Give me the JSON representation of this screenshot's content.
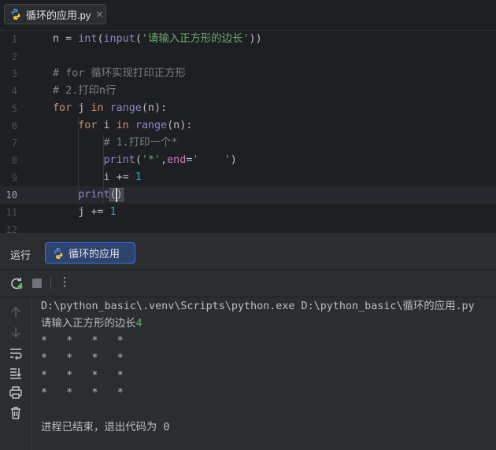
{
  "file_tab": {
    "label": "循环的应用.py",
    "close_glyph": "×",
    "icon": "python-icon"
  },
  "editor": {
    "line_numbers": [
      "1",
      "2",
      "3",
      "4",
      "5",
      "6",
      "7",
      "8",
      "9",
      "10",
      "11",
      "12"
    ],
    "current_line": "10",
    "lines": [
      {
        "tokens": [
          {
            "t": "n = ",
            "c": "id"
          },
          {
            "t": "int",
            "c": "bi"
          },
          {
            "t": "(",
            "c": "id"
          },
          {
            "t": "input",
            "c": "bi"
          },
          {
            "t": "(",
            "c": "id"
          },
          {
            "t": "'请输入正方形的边长'",
            "c": "str"
          },
          {
            "t": "))",
            "c": "id"
          }
        ]
      },
      {
        "tokens": []
      },
      {
        "tokens": [
          {
            "t": "# for 循环实现打印正方形",
            "c": "cmt"
          }
        ]
      },
      {
        "tokens": [
          {
            "t": "# 2.打印n行",
            "c": "cmt"
          }
        ]
      },
      {
        "tokens": [
          {
            "t": "for",
            "c": "kw"
          },
          {
            "t": " j ",
            "c": "id"
          },
          {
            "t": "in",
            "c": "kw"
          },
          {
            "t": " ",
            "c": "id"
          },
          {
            "t": "range",
            "c": "bi"
          },
          {
            "t": "(n):",
            "c": "id"
          }
        ]
      },
      {
        "tokens": [
          {
            "t": "    ",
            "c": "id"
          },
          {
            "t": "for",
            "c": "kw"
          },
          {
            "t": " i ",
            "c": "id"
          },
          {
            "t": "in",
            "c": "kw"
          },
          {
            "t": " ",
            "c": "id"
          },
          {
            "t": "range",
            "c": "bi"
          },
          {
            "t": "(n):",
            "c": "id"
          }
        ]
      },
      {
        "tokens": [
          {
            "t": "        ",
            "c": "id"
          },
          {
            "t": "# 1.打印一个*",
            "c": "cmt"
          }
        ]
      },
      {
        "tokens": [
          {
            "t": "        ",
            "c": "id"
          },
          {
            "t": "print",
            "c": "bi"
          },
          {
            "t": "(",
            "c": "id"
          },
          {
            "t": "'*'",
            "c": "str"
          },
          {
            "t": ",",
            "c": "id"
          },
          {
            "t": "end",
            "c": "par"
          },
          {
            "t": "=",
            "c": "id"
          },
          {
            "t": "'    '",
            "c": "str"
          },
          {
            "t": ")",
            "c": "id"
          }
        ]
      },
      {
        "tokens": [
          {
            "t": "        i += ",
            "c": "id"
          },
          {
            "t": "1",
            "c": "num"
          }
        ]
      },
      {
        "tokens": [
          {
            "t": "    ",
            "c": "id"
          },
          {
            "t": "print",
            "c": "bi"
          },
          {
            "t": "(",
            "c": "id",
            "hl": true
          },
          {
            "t": ")",
            "c": "id",
            "hl": true
          }
        ]
      },
      {
        "tokens": [
          {
            "t": "    j += ",
            "c": "id"
          },
          {
            "t": "1",
            "c": "num"
          }
        ]
      },
      {
        "tokens": []
      }
    ]
  },
  "run_panel": {
    "label": "运行",
    "tab_label": "循环的应用",
    "toolbar_icons": [
      "rerun-icon",
      "stop-icon",
      "more-options-icon"
    ],
    "more_glyph": "⋮",
    "side_icons": [
      "scroll-up-icon",
      "scroll-down-icon",
      "soft-wrap-icon",
      "scroll-to-end-icon",
      "print-icon",
      "clear-icon"
    ]
  },
  "console": {
    "command": "D:\\python_basic\\.venv\\Scripts\\python.exe D:\\python_basic\\循环的应用.py",
    "prompt": "请输入正方形的边长",
    "user_input": "4",
    "output_rows": [
      "*   *   *   *   ",
      "*   *   *   *   ",
      "*   *   *   *   ",
      "*   *   *   *   "
    ],
    "exit_message": "进程已结束，退出代码为 0"
  },
  "colors": {
    "background": "#1e1f22",
    "panel": "#2b2d30",
    "keyword": "#cf8e6d",
    "builtin": "#8888c6",
    "string": "#6aab73",
    "number": "#2aacb8",
    "comment": "#7a7e85",
    "parameter": "#c77dbb",
    "user_input": "#5fb865",
    "accent": "#3574f0"
  }
}
